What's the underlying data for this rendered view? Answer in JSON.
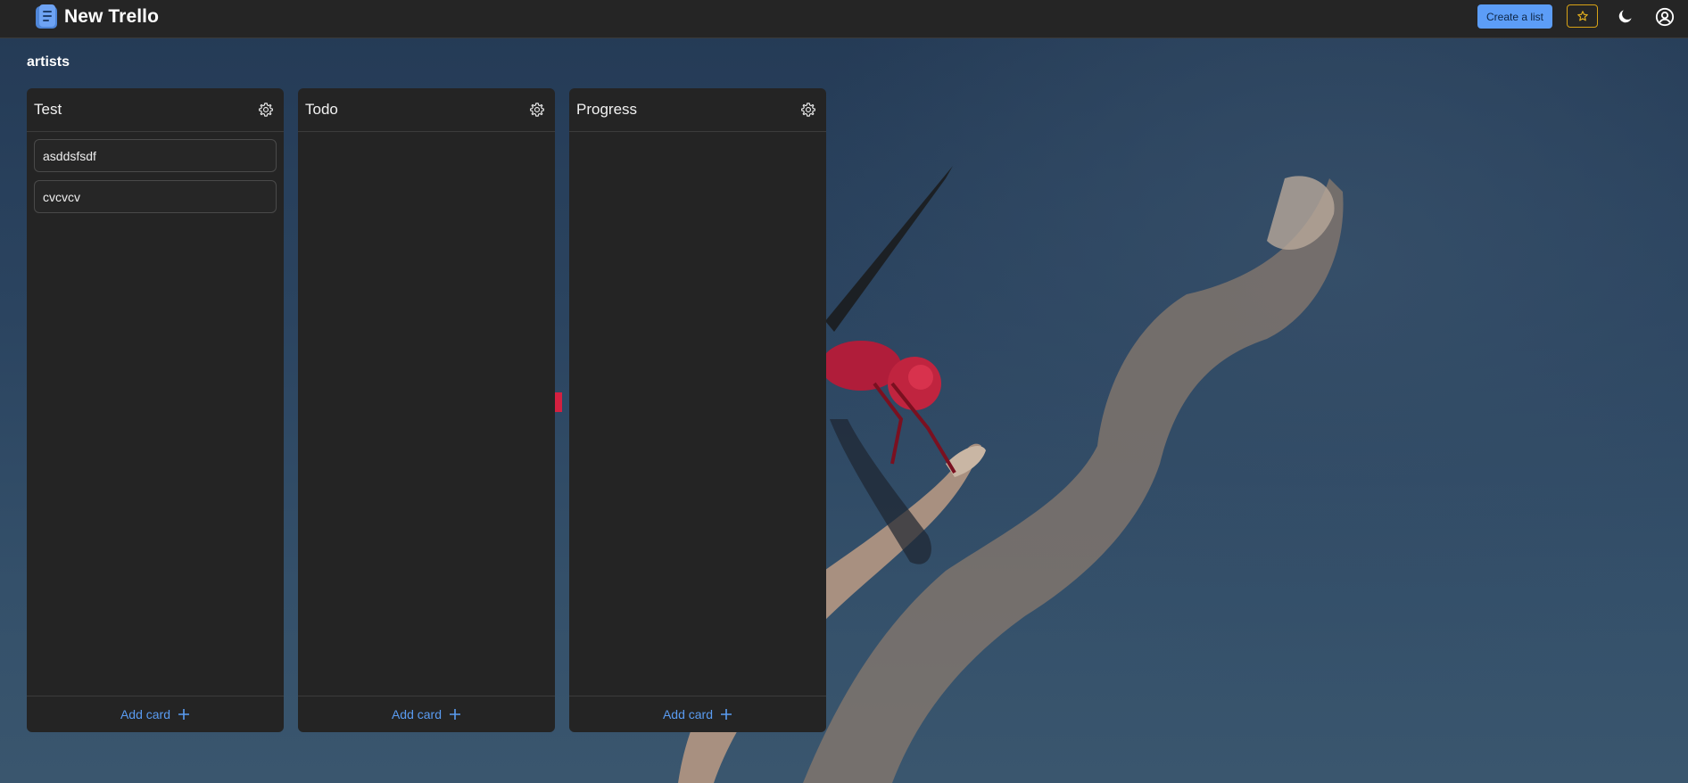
{
  "app": {
    "title": "New Trello",
    "brand_icon": "document-list-icon"
  },
  "header": {
    "create_list_label": "Create a list",
    "favorite_icon": "star-icon",
    "theme_icon": "moon-icon",
    "account_icon": "user-circle-icon"
  },
  "board": {
    "title": "artists",
    "lists": [
      {
        "title": "Test",
        "cards": [
          "asddsfsdf",
          "cvcvcv"
        ],
        "add_label": "Add card"
      },
      {
        "title": "Todo",
        "cards": [],
        "add_label": "Add card"
      },
      {
        "title": "Progress",
        "cards": [],
        "add_label": "Add card"
      }
    ]
  },
  "colors": {
    "accent": "#5c9df7",
    "star_border": "#d8a316",
    "panel": "#242424",
    "topbar": "#252525",
    "link": "#5a9cf2"
  }
}
